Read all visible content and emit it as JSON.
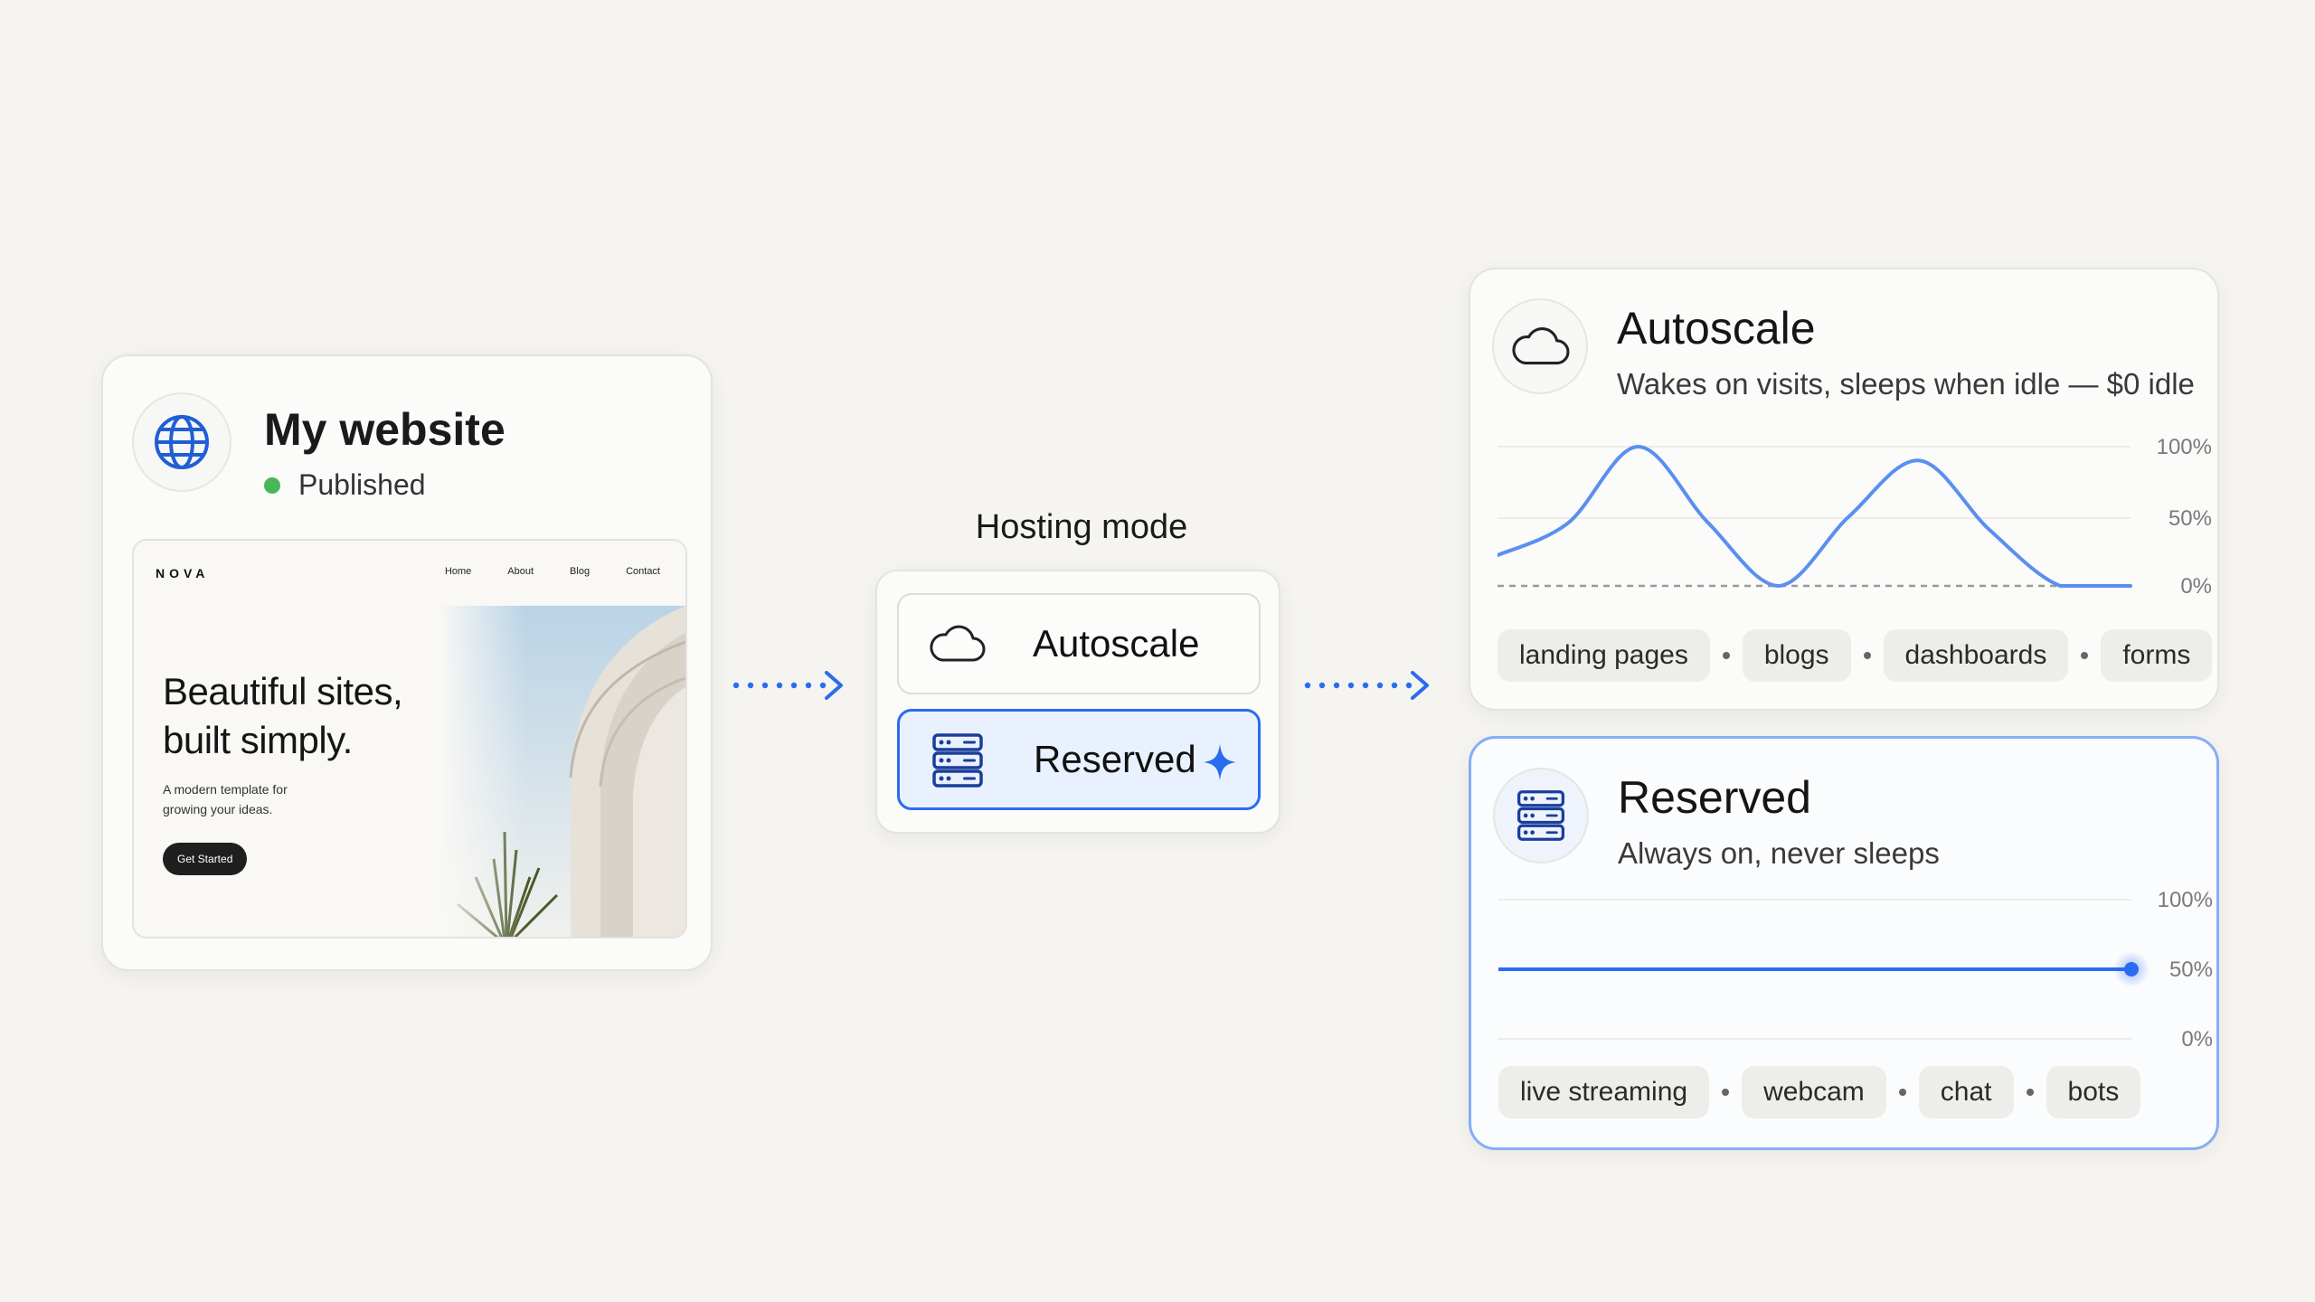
{
  "website_card": {
    "title": "My website",
    "status": "Published",
    "status_color": "#46b85a",
    "icon": "globe-icon",
    "preview": {
      "logo": "NOVA",
      "nav_links": [
        "Home",
        "About",
        "Blog",
        "Contact"
      ],
      "headline_line1": "Beautiful sites,",
      "headline_line2": "built simply.",
      "subtext_line1": "A modern template for",
      "subtext_line2": "growing your ideas.",
      "cta": "Get Started"
    }
  },
  "hosting": {
    "label": "Hosting mode",
    "options": [
      {
        "label": "Autoscale",
        "icon": "cloud-icon",
        "selected": false
      },
      {
        "label": "Reserved",
        "icon": "server-icon",
        "selected": true
      }
    ],
    "accent": "#2a6cf0"
  },
  "autoscale_card": {
    "title": "Autoscale",
    "description": "Wakes on visits, sleeps when idle — $0 idle",
    "icon": "cloud-icon",
    "tags": [
      "landing pages",
      "blogs",
      "dashboards",
      "forms"
    ],
    "chart_data": {
      "type": "line",
      "yticks": [
        "100%",
        "50%",
        "0%"
      ],
      "ylim": [
        0,
        100
      ],
      "series": [
        {
          "values": [
            22,
            45,
            100,
            45,
            0,
            50,
            90,
            40,
            0,
            0
          ]
        }
      ],
      "baseline": 0
    }
  },
  "reserved_card": {
    "title": "Reserved",
    "description": "Always on, never sleeps",
    "icon": "server-icon",
    "tags": [
      "live streaming",
      "webcam",
      "chat",
      "bots"
    ],
    "chart_data": {
      "type": "line",
      "yticks": [
        "100%",
        "50%",
        "0%"
      ],
      "ylim": [
        0,
        100
      ],
      "series": [
        {
          "values": [
            50,
            50
          ]
        }
      ]
    }
  }
}
